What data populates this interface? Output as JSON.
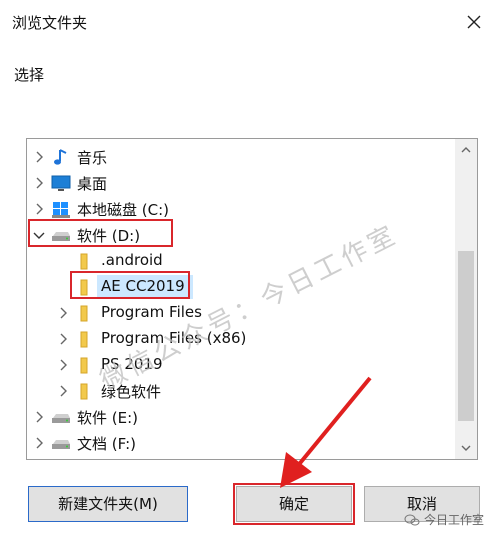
{
  "window": {
    "title": "浏览文件夹",
    "prompt": "选择"
  },
  "tree": {
    "items": [
      {
        "label": "音乐",
        "icon": "music-note-icon",
        "expanded": false
      },
      {
        "label": "桌面",
        "icon": "desktop-icon",
        "expanded": false
      },
      {
        "label": "本地磁盘 (C:)",
        "icon": "windows-drive-icon",
        "expanded": false
      },
      {
        "label": "软件 (D:)",
        "icon": "drive-icon",
        "expanded": true
      },
      {
        "label": ".android",
        "icon": "folder-icon",
        "expanded": false
      },
      {
        "label": "AE CC2019",
        "icon": "folder-icon",
        "selected": true
      },
      {
        "label": "Program Files",
        "icon": "folder-icon",
        "expanded": false
      },
      {
        "label": "Program Files (x86)",
        "icon": "folder-icon",
        "expanded": false
      },
      {
        "label": "PS 2019",
        "icon": "folder-icon",
        "expanded": false
      },
      {
        "label": "绿色软件",
        "icon": "folder-icon",
        "expanded": false
      },
      {
        "label": "软件 (E:)",
        "icon": "drive-icon",
        "expanded": false
      },
      {
        "label": "文档 (F:)",
        "icon": "drive-icon",
        "expanded": false
      }
    ]
  },
  "buttons": {
    "new_folder": "新建文件夹(M)",
    "ok": "确定",
    "cancel": "取消"
  },
  "watermark": {
    "text": "微信公众号：今日工作室",
    "credit": "今日工作室"
  },
  "colors": {
    "highlight_red": "#d9262b",
    "selection_blue": "#cce8ff",
    "folder_yellow": "#f2c94c",
    "music_blue": "#1e73d8"
  }
}
